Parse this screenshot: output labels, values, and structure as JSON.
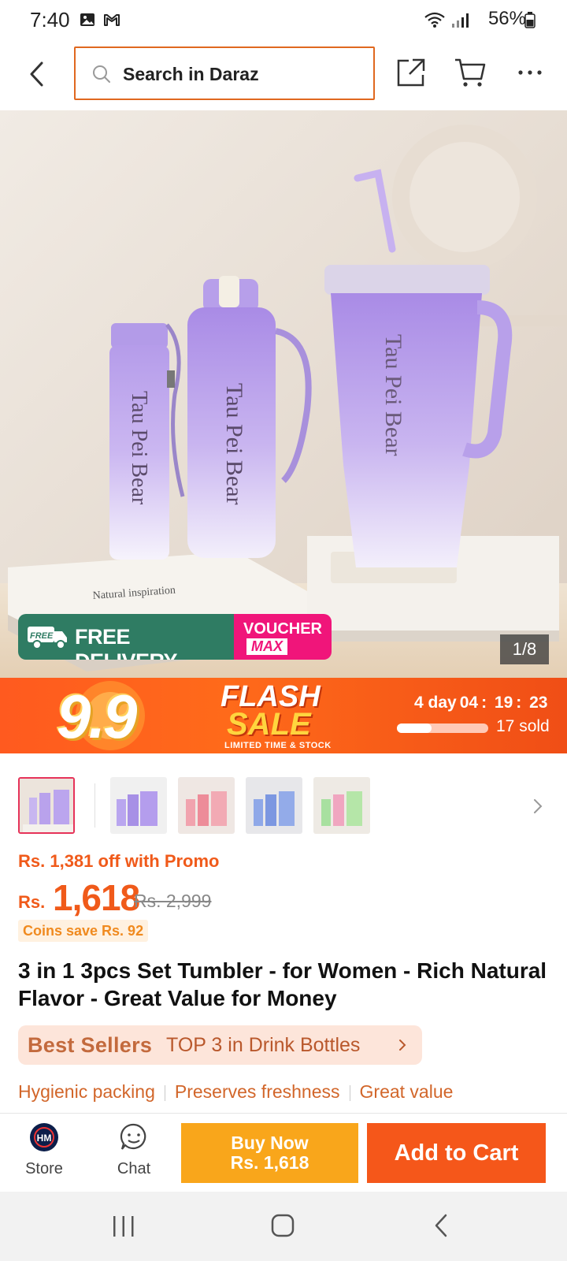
{
  "status_bar": {
    "time": "7:40",
    "battery_pct": "56%",
    "icons": [
      "image-icon",
      "gmail-icon",
      "wifi-icon",
      "signal-icon",
      "battery-icon"
    ]
  },
  "top_nav": {
    "back_icon": "chevron-left-icon",
    "search_placeholder": "Search in Daraz",
    "share_icon": "share-icon",
    "cart_icon": "cart-icon",
    "more_icon": "more-dots-icon",
    "search_border_color": "#e0681f"
  },
  "gallery": {
    "counter": "1/8",
    "product_print": "Tau Pei Bear",
    "book_text": "Natural inspiration",
    "badges": {
      "free_tag": "FREE",
      "free_delivery": "FREE DELIVERY",
      "voucher_line1": "VOUCHER",
      "voucher_line2": "MAX"
    }
  },
  "flash_sale": {
    "event": "9.9",
    "word1": "FLASH",
    "word2": "SALE",
    "subtitle": "LIMITED TIME & STOCK",
    "countdown_days": "4 day",
    "countdown_h": "04",
    "countdown_m": "19",
    "countdown_s": "23",
    "sold_progress": 0.38,
    "sold": "17 sold"
  },
  "thumbnails": {
    "count": 5,
    "active_index": 0,
    "next_icon": "chevron-right-icon"
  },
  "pricing": {
    "promo": "Rs. 1,381 off with Promo",
    "currency": "Rs.",
    "price": "1,618",
    "original": "Rs. 2,999",
    "coins": "Coins save Rs. 92",
    "accent_color": "#f05a1a"
  },
  "product": {
    "title": "3 in 1 3pcs Set Tumbler - for Women - Rich Natural Flavor - Great Value for Money"
  },
  "best_sellers": {
    "label": "Best Sellers",
    "rank": "TOP 3 in Drink Bottles"
  },
  "tags": [
    "Hygienic packing",
    "Preserves freshness",
    "Great value"
  ],
  "action_bar": {
    "store_label": "Store",
    "store_logo_text": "HM",
    "chat_label": "Chat",
    "buy_now_line1": "Buy Now",
    "buy_now_line2": "Rs. 1,618",
    "add_to_cart": "Add to Cart"
  },
  "system_nav": {
    "icons": [
      "recents-icon",
      "home-icon",
      "back-icon"
    ]
  }
}
